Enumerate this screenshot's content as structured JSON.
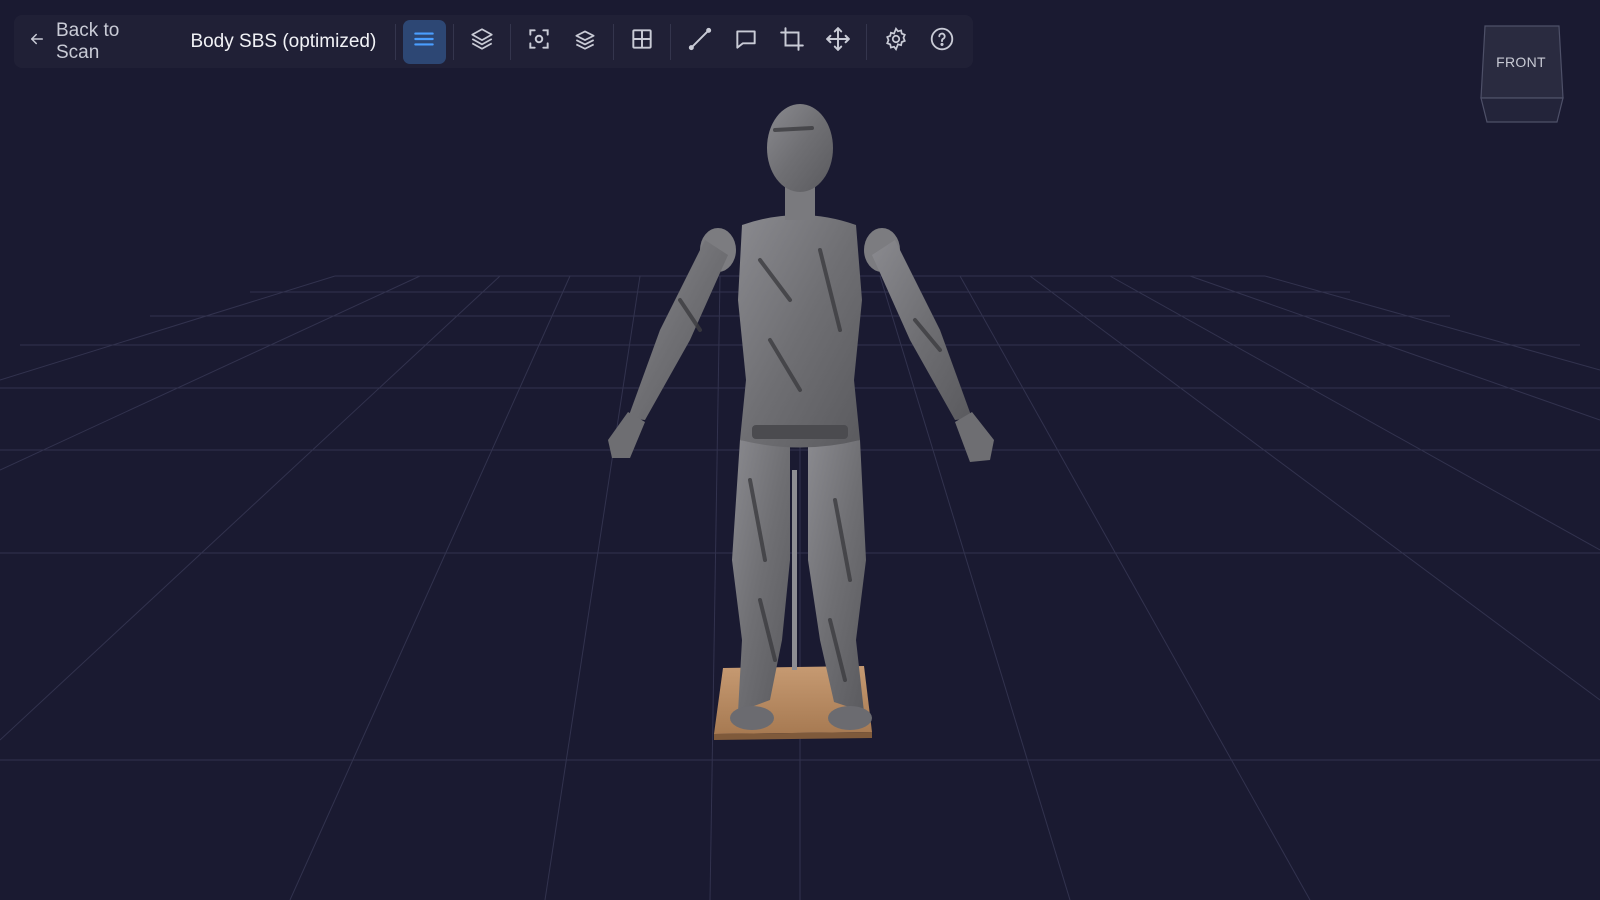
{
  "toolbar": {
    "back_label": "Back to Scan",
    "title": "Body SBS (optimized)",
    "tools": [
      {
        "name": "menu-icon",
        "active": true
      },
      {
        "name": "layers-icon"
      },
      {
        "name": "focus-icon"
      },
      {
        "name": "stack-icon"
      },
      {
        "name": "grid-icon"
      },
      {
        "name": "measure-icon"
      },
      {
        "name": "comment-icon"
      },
      {
        "name": "crop-icon"
      },
      {
        "name": "move-icon"
      },
      {
        "name": "settings-icon"
      },
      {
        "name": "help-icon"
      }
    ]
  },
  "view_cube": {
    "face_label": "FRONT"
  },
  "colors": {
    "background": "#1a1a31",
    "toolbar": "#202036",
    "accent": "#4a9eff",
    "icon": "#c9cbd6"
  }
}
